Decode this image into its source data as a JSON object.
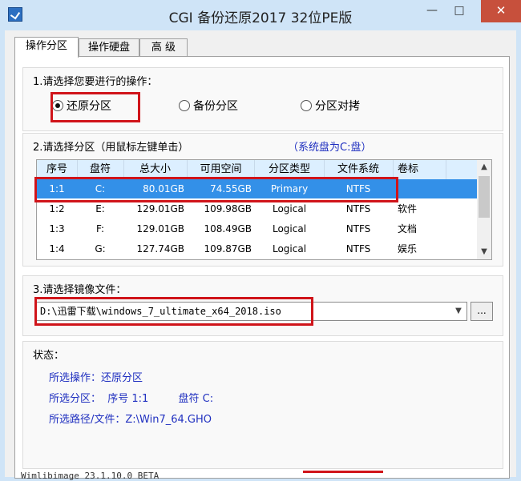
{
  "window": {
    "title": "CGI 备份还原2017 32位PE版",
    "minimize": "—",
    "maximize": "□",
    "close": "✕"
  },
  "tabs": [
    {
      "label": "操作分区",
      "active": true
    },
    {
      "label": "操作硬盘",
      "active": false
    },
    {
      "label": "高 级",
      "active": false
    }
  ],
  "operation": {
    "title": "1.请选择您要进行的操作：",
    "options": [
      {
        "label": "还原分区",
        "selected": true
      },
      {
        "label": "备份分区",
        "selected": false
      },
      {
        "label": "分区对拷",
        "selected": false
      }
    ]
  },
  "partition": {
    "title": "2.请选择分区（用鼠标左键单击）",
    "note": "（系统盘为C:盘）",
    "columns": [
      "序号",
      "盘符",
      "总大小",
      "可用空间",
      "分区类型",
      "文件系统",
      "卷标"
    ],
    "rows": [
      [
        "1:1",
        "C:",
        "80.01GB",
        "74.55GB",
        "Primary",
        "NTFS",
        ""
      ],
      [
        "1:2",
        "E:",
        "129.01GB",
        "109.98GB",
        "Logical",
        "NTFS",
        "软件"
      ],
      [
        "1:3",
        "F:",
        "129.01GB",
        "108.49GB",
        "Logical",
        "NTFS",
        "文档"
      ],
      [
        "1:4",
        "G:",
        "127.74GB",
        "109.87GB",
        "Logical",
        "NTFS",
        "娱乐"
      ]
    ],
    "selected_row": 0
  },
  "image": {
    "title": "3.请选择镜像文件：",
    "value": "D:\\迅雷下载\\windows_7_ultimate_x64_2018.iso",
    "browse": "..."
  },
  "status": {
    "title": "状态：",
    "op_line": "所选操作：还原分区",
    "part_line": "所选分区：  序号 1:1         盘符 C:",
    "path_line": "所选路径/文件：Z:\\Win7_64.GHO"
  },
  "footer": {
    "text": "Wimlibimage 23.1.10.0 BETA"
  },
  "colors": {
    "highlight_border": "#d0141a",
    "selection": "#3390e8",
    "status_text": "#2030c0"
  }
}
